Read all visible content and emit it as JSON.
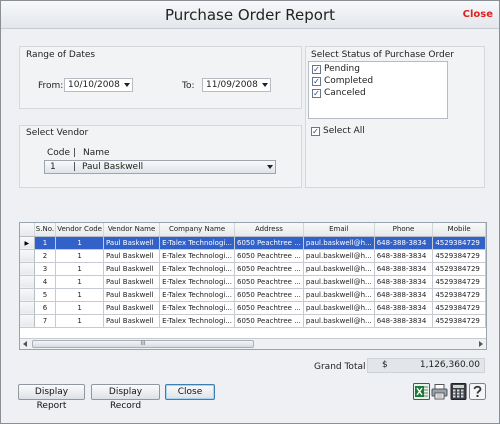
{
  "window": {
    "title": "Purchase Order Report",
    "close_label": "Close"
  },
  "dates": {
    "group_label": "Range of Dates",
    "from_label": "From:",
    "from_value": "10/10/2008",
    "to_label": "To:",
    "to_value": "11/09/2008"
  },
  "status": {
    "group_label": "Select Status of Purchase Order",
    "options": [
      {
        "label": "Pending",
        "checked": true
      },
      {
        "label": "Completed",
        "checked": true
      },
      {
        "label": "Canceled",
        "checked": true
      }
    ],
    "select_all_label": "Select All",
    "select_all_checked": true
  },
  "vendor": {
    "group_label": "Select Vendor",
    "header_code": "Code",
    "header_sep": "|",
    "header_name": "Name",
    "selected_code": "1",
    "selected_sep": "|",
    "selected_name": "Paul Baskwell"
  },
  "grid": {
    "columns": [
      "S.No.",
      "Vendor Code",
      "Vendor Name",
      "Company Name",
      "Address",
      "Email",
      "Phone",
      "Mobile"
    ],
    "rows": [
      [
        "1",
        "1",
        "Paul Baskwell",
        "E-Talex Technologi...",
        "6050 Peachtree ...",
        "paul.baskwell@h...",
        "648-388-3834",
        "4529384729"
      ],
      [
        "2",
        "1",
        "Paul Baskwell",
        "E-Talex Technologi...",
        "6050 Peachtree ...",
        "paul.baskwell@h...",
        "648-388-3834",
        "4529384729"
      ],
      [
        "3",
        "1",
        "Paul Baskwell",
        "E-Talex Technologi...",
        "6050 Peachtree ...",
        "paul.baskwell@h...",
        "648-388-3834",
        "4529384729"
      ],
      [
        "4",
        "1",
        "Paul Baskwell",
        "E-Talex Technologi...",
        "6050 Peachtree ...",
        "paul.baskwell@h...",
        "648-388-3834",
        "4529384729"
      ],
      [
        "5",
        "1",
        "Paul Baskwell",
        "E-Talex Technologi...",
        "6050 Peachtree ...",
        "paul.baskwell@h...",
        "648-388-3834",
        "4529384729"
      ],
      [
        "6",
        "1",
        "Paul Baskwell",
        "E-Talex Technologi...",
        "6050 Peachtree ...",
        "paul.baskwell@h...",
        "648-388-3834",
        "4529384729"
      ],
      [
        "7",
        "1",
        "Paul Baskwell",
        "E-Talex Technologi...",
        "6050 Peachtree ...",
        "paul.baskwell@h...",
        "648-388-3834",
        "4529384729"
      ]
    ],
    "selected_row_index": 0,
    "current_row_marker": "▶",
    "scroll_thumb_grip": "III"
  },
  "total": {
    "label": "Grand Total",
    "currency": "$",
    "value": "1,126,360.00"
  },
  "buttons": {
    "display_report": "Display Report",
    "display_record": "Display Record",
    "close": "Close"
  },
  "icons": [
    "excel-icon",
    "print-icon",
    "calculator-icon",
    "help-icon"
  ],
  "colors": {
    "close_link": "#dd2222",
    "selected_row": "#3161c9",
    "excel_green": "#1f7a3a"
  }
}
